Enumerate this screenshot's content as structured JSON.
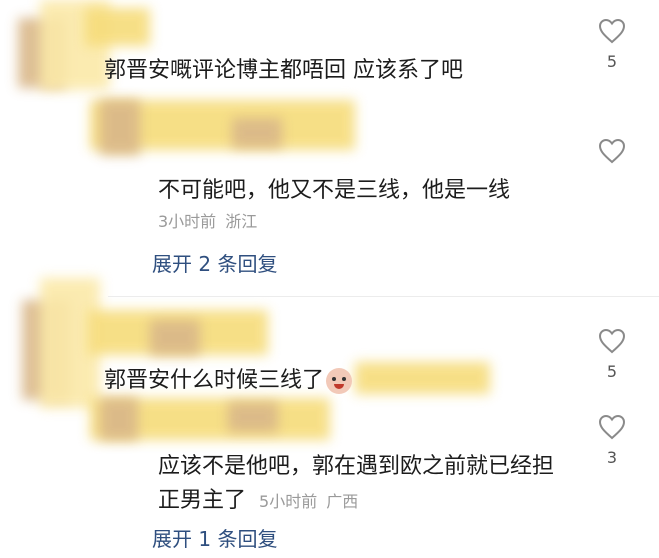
{
  "comments": [
    {
      "text": "郭晋安嘅评论博主都唔回 应该系了吧",
      "likes": "5",
      "reply": {
        "text": "不可能吧，他又不是三线，他是一线",
        "time": "3小时前",
        "location": "浙江",
        "expand": "展开 2 条回复"
      }
    },
    {
      "text": "郭晋安什么时候三线了",
      "likes": "5",
      "reply": {
        "text_line1": "应该不是他吧，郭在遇到欧之前就已经担",
        "text_line2": "正男主了",
        "likes": "3",
        "time": "5小时前",
        "location": "广西",
        "expand": "展开 1 条回复"
      }
    }
  ]
}
